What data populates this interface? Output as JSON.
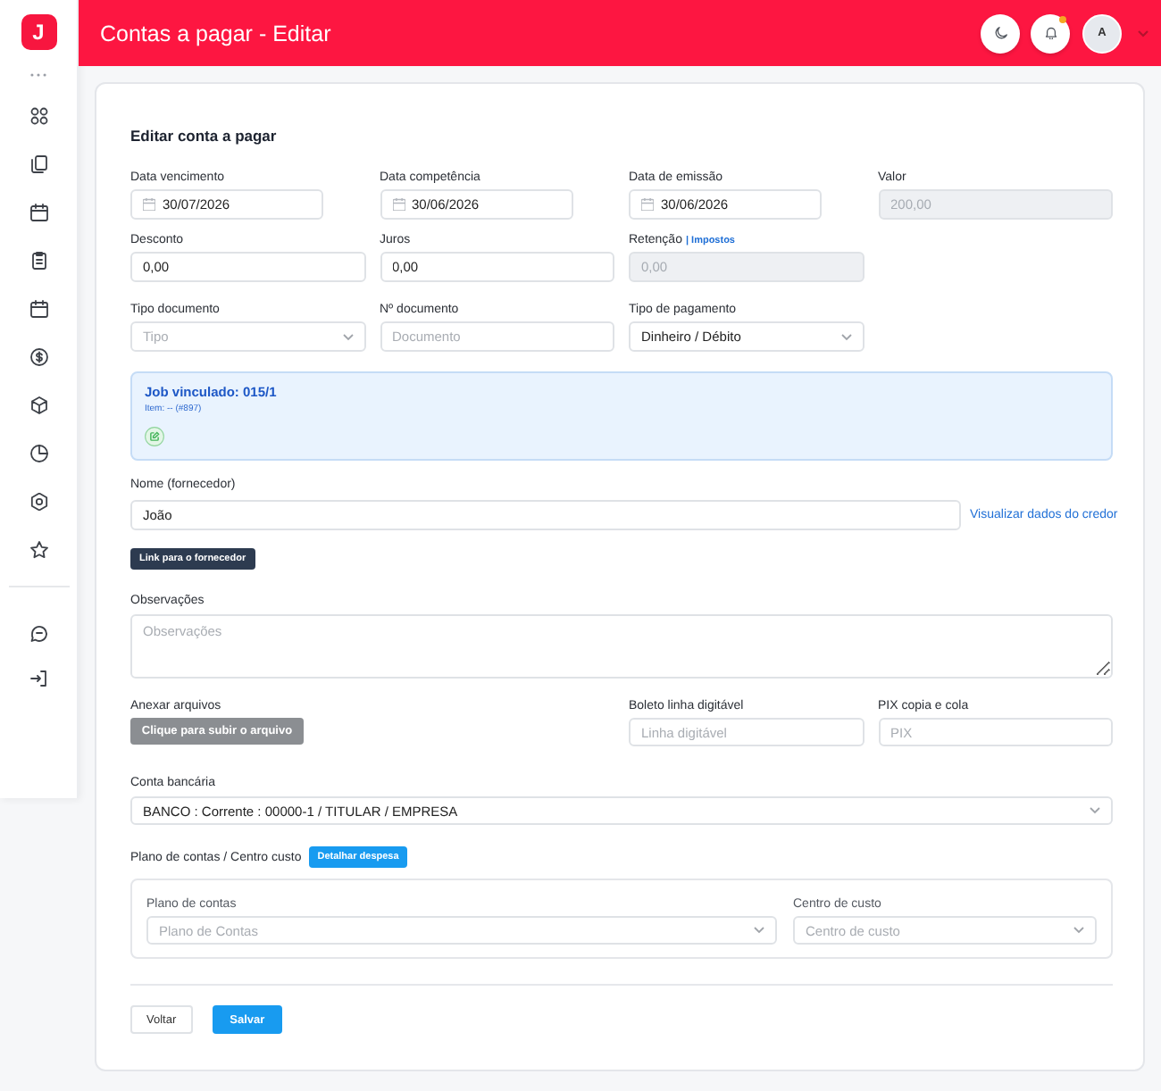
{
  "sidebar": {
    "logo": "J"
  },
  "header": {
    "title": "Contas a pagar - Editar",
    "has_unread": true,
    "avatar": "A"
  },
  "form": {
    "title": "Editar conta a pagar",
    "rows": [
      [
        {
          "kind": "date",
          "label": "Data vencimento",
          "value": "30/07/2026",
          "disabled": false
        },
        {
          "kind": "date",
          "label": "Data competência",
          "value": "30/06/2026",
          "disabled": false
        },
        {
          "kind": "date",
          "label": "Data de emissão",
          "value": "30/06/2026",
          "disabled": false
        },
        {
          "kind": "text",
          "label": "Valor",
          "value": "200,00",
          "disabled": true
        }
      ],
      [
        {
          "kind": "text",
          "label": "Desconto",
          "value": "0,00",
          "disabled": false
        },
        {
          "kind": "text",
          "label": "Juros",
          "value": "0,00",
          "disabled": false
        },
        {
          "kind": "text",
          "label": "Retenção",
          "label_link": "| Impostos",
          "value": "0,00",
          "disabled": true
        }
      ],
      [
        {
          "kind": "select",
          "label": "Tipo documento",
          "placeholder": "Tipo",
          "disabled": false
        },
        {
          "kind": "text",
          "label": "Nº documento",
          "placeholder": "Documento",
          "disabled": false
        },
        {
          "kind": "select",
          "label": "Tipo de pagamento",
          "value": "Dinheiro / Débito",
          "disabled": false
        }
      ]
    ],
    "job": {
      "title": "Job vinculado: 015/1",
      "item": "Item: -- (#897)"
    },
    "supplier": {
      "label": "Nome (fornecedor)",
      "value": "João",
      "link": "Visualizar dados do credor",
      "button": "Link para o fornecedor"
    },
    "notes": {
      "label": "Observações",
      "placeholder": "Observações"
    },
    "attachments": {
      "label": "Anexar arquivos",
      "button": "Clique para subir o arquivo"
    },
    "payment_codes": [
      {
        "label": "Boleto linha digitável",
        "placeholder": "Linha digitável"
      },
      {
        "label": "PIX copia e cola",
        "placeholder": "PIX"
      }
    ],
    "bank_account": {
      "label": "Conta bancária",
      "value": "BANCO : Corrente : 00000-1 / TITULAR / EMPRESA"
    },
    "accounts_plan": {
      "label": "Plano de contas / Centro custo",
      "button": "Detalhar despesa",
      "selects": [
        {
          "label": "Plano de contas",
          "placeholder": "Plano de Contas"
        },
        {
          "label": "Centro de custo",
          "placeholder": "Centro de custo"
        }
      ]
    },
    "actions": [
      {
        "kind": "secondary",
        "label": "Voltar"
      },
      {
        "kind": "primary",
        "label": "Salvar"
      }
    ]
  }
}
